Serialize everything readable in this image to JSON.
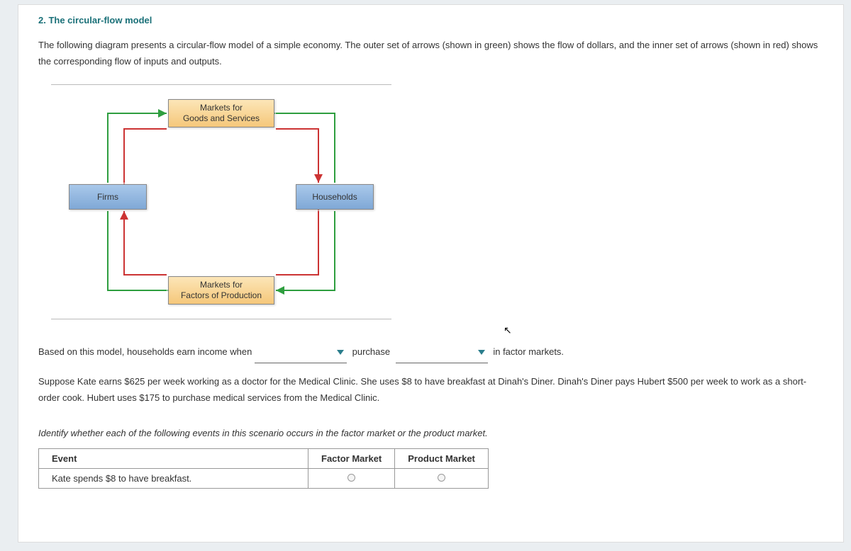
{
  "heading": "2. The circular-flow model",
  "intro": "The following diagram presents a circular-flow model of a simple economy. The outer set of arrows (shown in green) shows the flow of dollars, and the inner set of arrows (shown in red) shows the corresponding flow of inputs and outputs.",
  "diagram": {
    "top": "Markets for\nGoods and Services",
    "bottom": "Markets for\nFactors of Production",
    "left": "Firms",
    "right": "Households"
  },
  "sentence": {
    "part1": "Based on this model, households earn income when",
    "part2": "purchase",
    "part3": "in factor markets."
  },
  "scenario": "Suppose Kate earns $625 per week working as a doctor for the Medical Clinic. She uses $8 to have breakfast at Dinah's Diner. Dinah's Diner pays Hubert $500 per week to work as a short-order cook. Hubert uses $175 to purchase medical services from the Medical Clinic.",
  "identify": "Identify whether each of the following events in this scenario occurs in the factor market or the product market.",
  "table": {
    "headers": [
      "Event",
      "Factor Market",
      "Product Market"
    ],
    "rows": [
      {
        "event": "Kate spends $8 to have breakfast."
      }
    ]
  }
}
